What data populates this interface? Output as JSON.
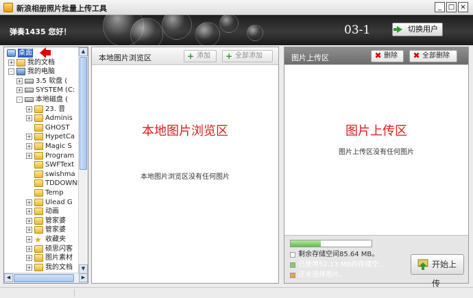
{
  "window": {
    "title": "新浪相册照片批量上传工具",
    "min_icon": "minimize-icon",
    "max_icon": "maximize-icon",
    "close_icon": "close-icon"
  },
  "header": {
    "greeting": "弹奏1435 您好！",
    "user_code": "03-1",
    "switch_user_label": "切换用户"
  },
  "tree": {
    "items": [
      {
        "label": "桌面",
        "icon": "desktop-icon",
        "selected": true
      },
      {
        "label": "我的文档",
        "icon": "folder-icon"
      },
      {
        "label": "我的电脑",
        "icon": "computer-icon"
      },
      {
        "label": "3.5 软盘 (",
        "icon": "floppy-icon"
      },
      {
        "label": "SYSTEM (C:",
        "icon": "drive-icon"
      },
      {
        "label": "本地磁盘 (",
        "icon": "drive-icon"
      },
      {
        "label": "23.  音",
        "icon": "folder-icon"
      },
      {
        "label": "Adminis",
        "icon": "folder-icon"
      },
      {
        "label": "GHOST",
        "icon": "folder-icon"
      },
      {
        "label": "HypetCa",
        "icon": "folder-icon"
      },
      {
        "label": "Magic S",
        "icon": "folder-icon"
      },
      {
        "label": "Program",
        "icon": "folder-icon"
      },
      {
        "label": "SWFText",
        "icon": "folder-icon"
      },
      {
        "label": "swishma",
        "icon": "folder-icon"
      },
      {
        "label": "TDDOWNL",
        "icon": "folder-icon"
      },
      {
        "label": "Temp",
        "icon": "folder-icon"
      },
      {
        "label": "Ulead G",
        "icon": "folder-icon"
      },
      {
        "label": "动画",
        "icon": "folder-icon"
      },
      {
        "label": "管家婆",
        "icon": "folder-icon"
      },
      {
        "label": "管家婆",
        "icon": "folder-icon"
      },
      {
        "label": "收藏夹",
        "icon": "star-icon"
      },
      {
        "label": "硕思闪客",
        "icon": "folder-icon"
      },
      {
        "label": "图片素材",
        "icon": "folder-icon"
      },
      {
        "label": "我的文档",
        "icon": "folder-icon"
      }
    ]
  },
  "browse": {
    "title": "本地图片浏览区",
    "add_label": "添加",
    "add_all_label": "全部添加",
    "big_label": "本地图片浏览区",
    "empty_message": "本地图片浏览区没有任何图片"
  },
  "upload": {
    "title": "图片上传区",
    "delete_label": "删除",
    "delete_all_label": "全部删除",
    "big_label": "图片上传区",
    "empty_message": "图片上传区没有任何图片",
    "storage_used_fraction": 0.37,
    "free_text": "剩余存储空间85.64 MB。",
    "used_text": "已使用52.13 MB的存储空...",
    "note_text": "还未选择图片。",
    "start_label": "开始上传"
  },
  "colors": {
    "accent_red": "#e01a1a",
    "header_dark": "#2a2a2a",
    "progress_green": "#5fbf47",
    "selection_blue": "#2f5fbf"
  }
}
